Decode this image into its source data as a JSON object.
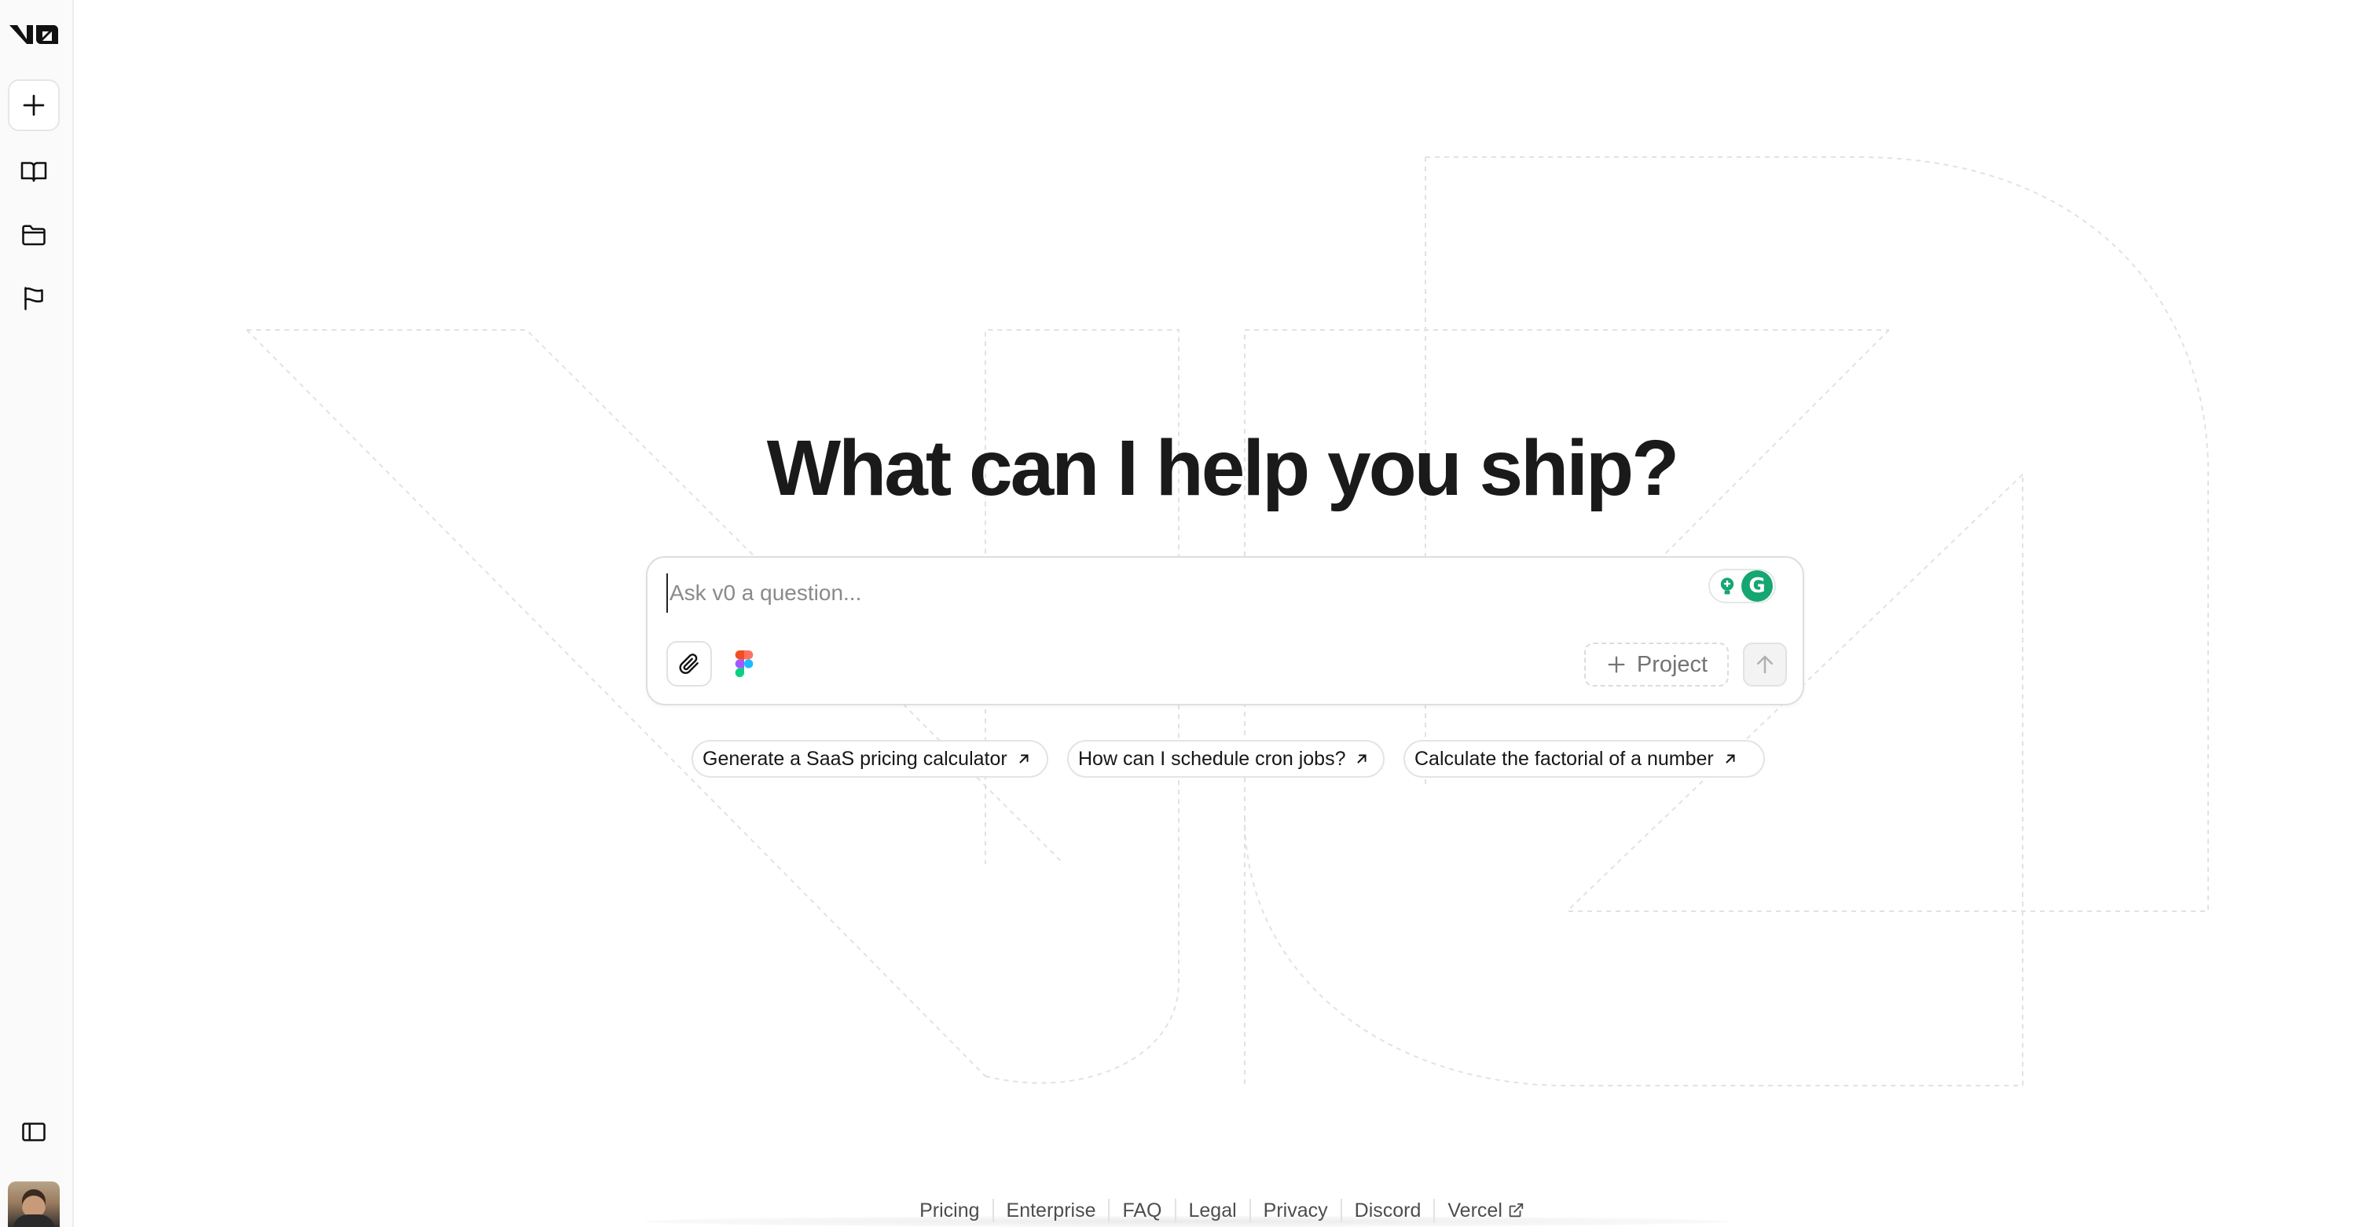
{
  "app": {
    "logo_text": "v0"
  },
  "sidebar": {
    "items": [
      {
        "name": "new-chat",
        "icon": "plus-icon"
      },
      {
        "name": "library",
        "icon": "book-open-icon"
      },
      {
        "name": "projects",
        "icon": "folder-icon"
      },
      {
        "name": "feedback",
        "icon": "flag-icon"
      }
    ],
    "bottom": [
      {
        "name": "toggle-sidebar",
        "icon": "panel-left-icon"
      },
      {
        "name": "user-avatar",
        "icon": "avatar"
      }
    ]
  },
  "main": {
    "headline": "What can I help you ship?",
    "prompt": {
      "placeholder": "Ask v0 a question...",
      "value": "",
      "project_label": "Project"
    },
    "suggestions": [
      "Generate a SaaS pricing calculator",
      "How can I schedule cron jobs?",
      "Calculate the factorial of a number"
    ]
  },
  "footer": {
    "links": [
      "Pricing",
      "Enterprise",
      "FAQ",
      "Legal",
      "Privacy",
      "Discord",
      "Vercel"
    ]
  },
  "colors": {
    "background": "#ffffff",
    "sidebar_bg": "#fafafa",
    "text": "#171717",
    "muted": "#737373",
    "grammarly_green": "#15a672"
  }
}
